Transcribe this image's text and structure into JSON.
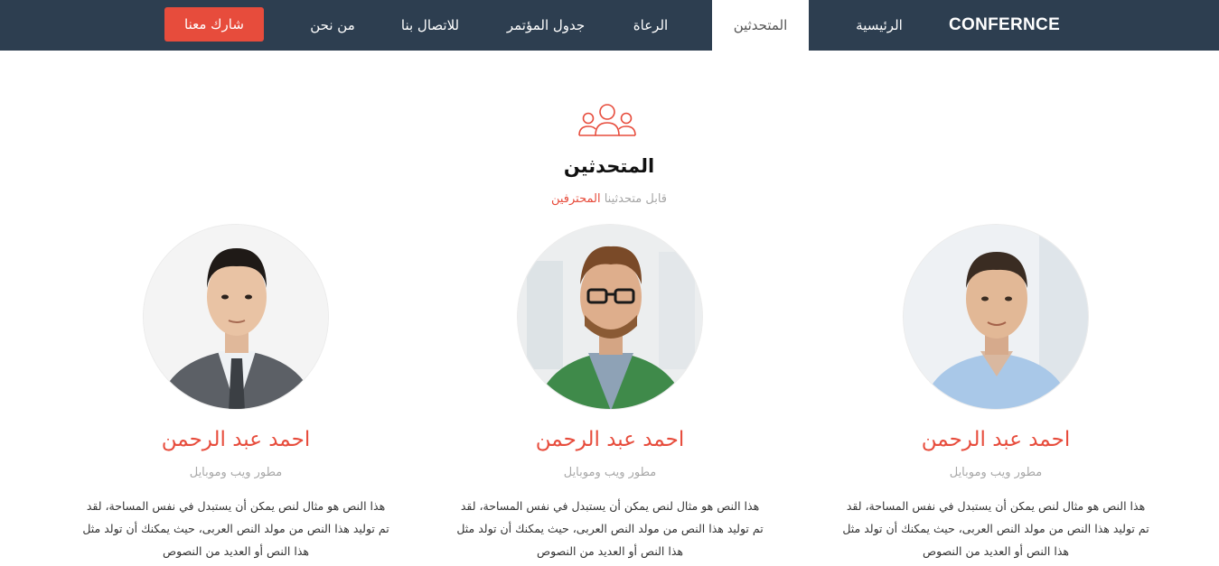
{
  "navbar": {
    "brand": "CONFERNCE",
    "items": [
      {
        "label": "الرئيسية"
      },
      {
        "label": "المتحدثين"
      },
      {
        "label": "الرعاة"
      },
      {
        "label": "جدول المؤتمر"
      },
      {
        "label": "للاتصال بنا"
      },
      {
        "label": "من نحن"
      }
    ],
    "active_item": "المتحدثين",
    "cta_label": "شارك معنا"
  },
  "section": {
    "icon": "users-icon",
    "title": "المتحدثين",
    "subtitle_prefix": "قابل متحدثينا",
    "subtitle_highlight": "المحترفين"
  },
  "speakers": [
    {
      "name": "احمد عبد الرحمن",
      "role": "مطور ويب وموبايل",
      "bio": "هذا النص هو مثال لنص يمكن أن يستبدل في نفس المساحة، لقد تم توليد هذا النص من مولد النص العربى، حيث يمكنك أن تولد مثل هذا النص أو العديد من النصوص"
    },
    {
      "name": "احمد عبد الرحمن",
      "role": "مطور ويب وموبايل",
      "bio": "هذا النص هو مثال لنص يمكن أن يستبدل في نفس المساحة، لقد تم توليد هذا النص من مولد النص العربى، حيث يمكنك أن تولد مثل هذا النص أو العديد من النصوص"
    },
    {
      "name": "احمد عبد الرحمن",
      "role": "مطور ويب وموبايل",
      "bio": "هذا النص هو مثال لنص يمكن أن يستبدل في نفس المساحة، لقد تم توليد هذا النص من مولد النص العربى، حيث يمكنك أن تولد مثل هذا النص أو العديد من النصوص"
    }
  ],
  "colors": {
    "navbar_bg": "#2d3e50",
    "accent": "#e74c3c",
    "muted_text": "#a8a8a8"
  }
}
